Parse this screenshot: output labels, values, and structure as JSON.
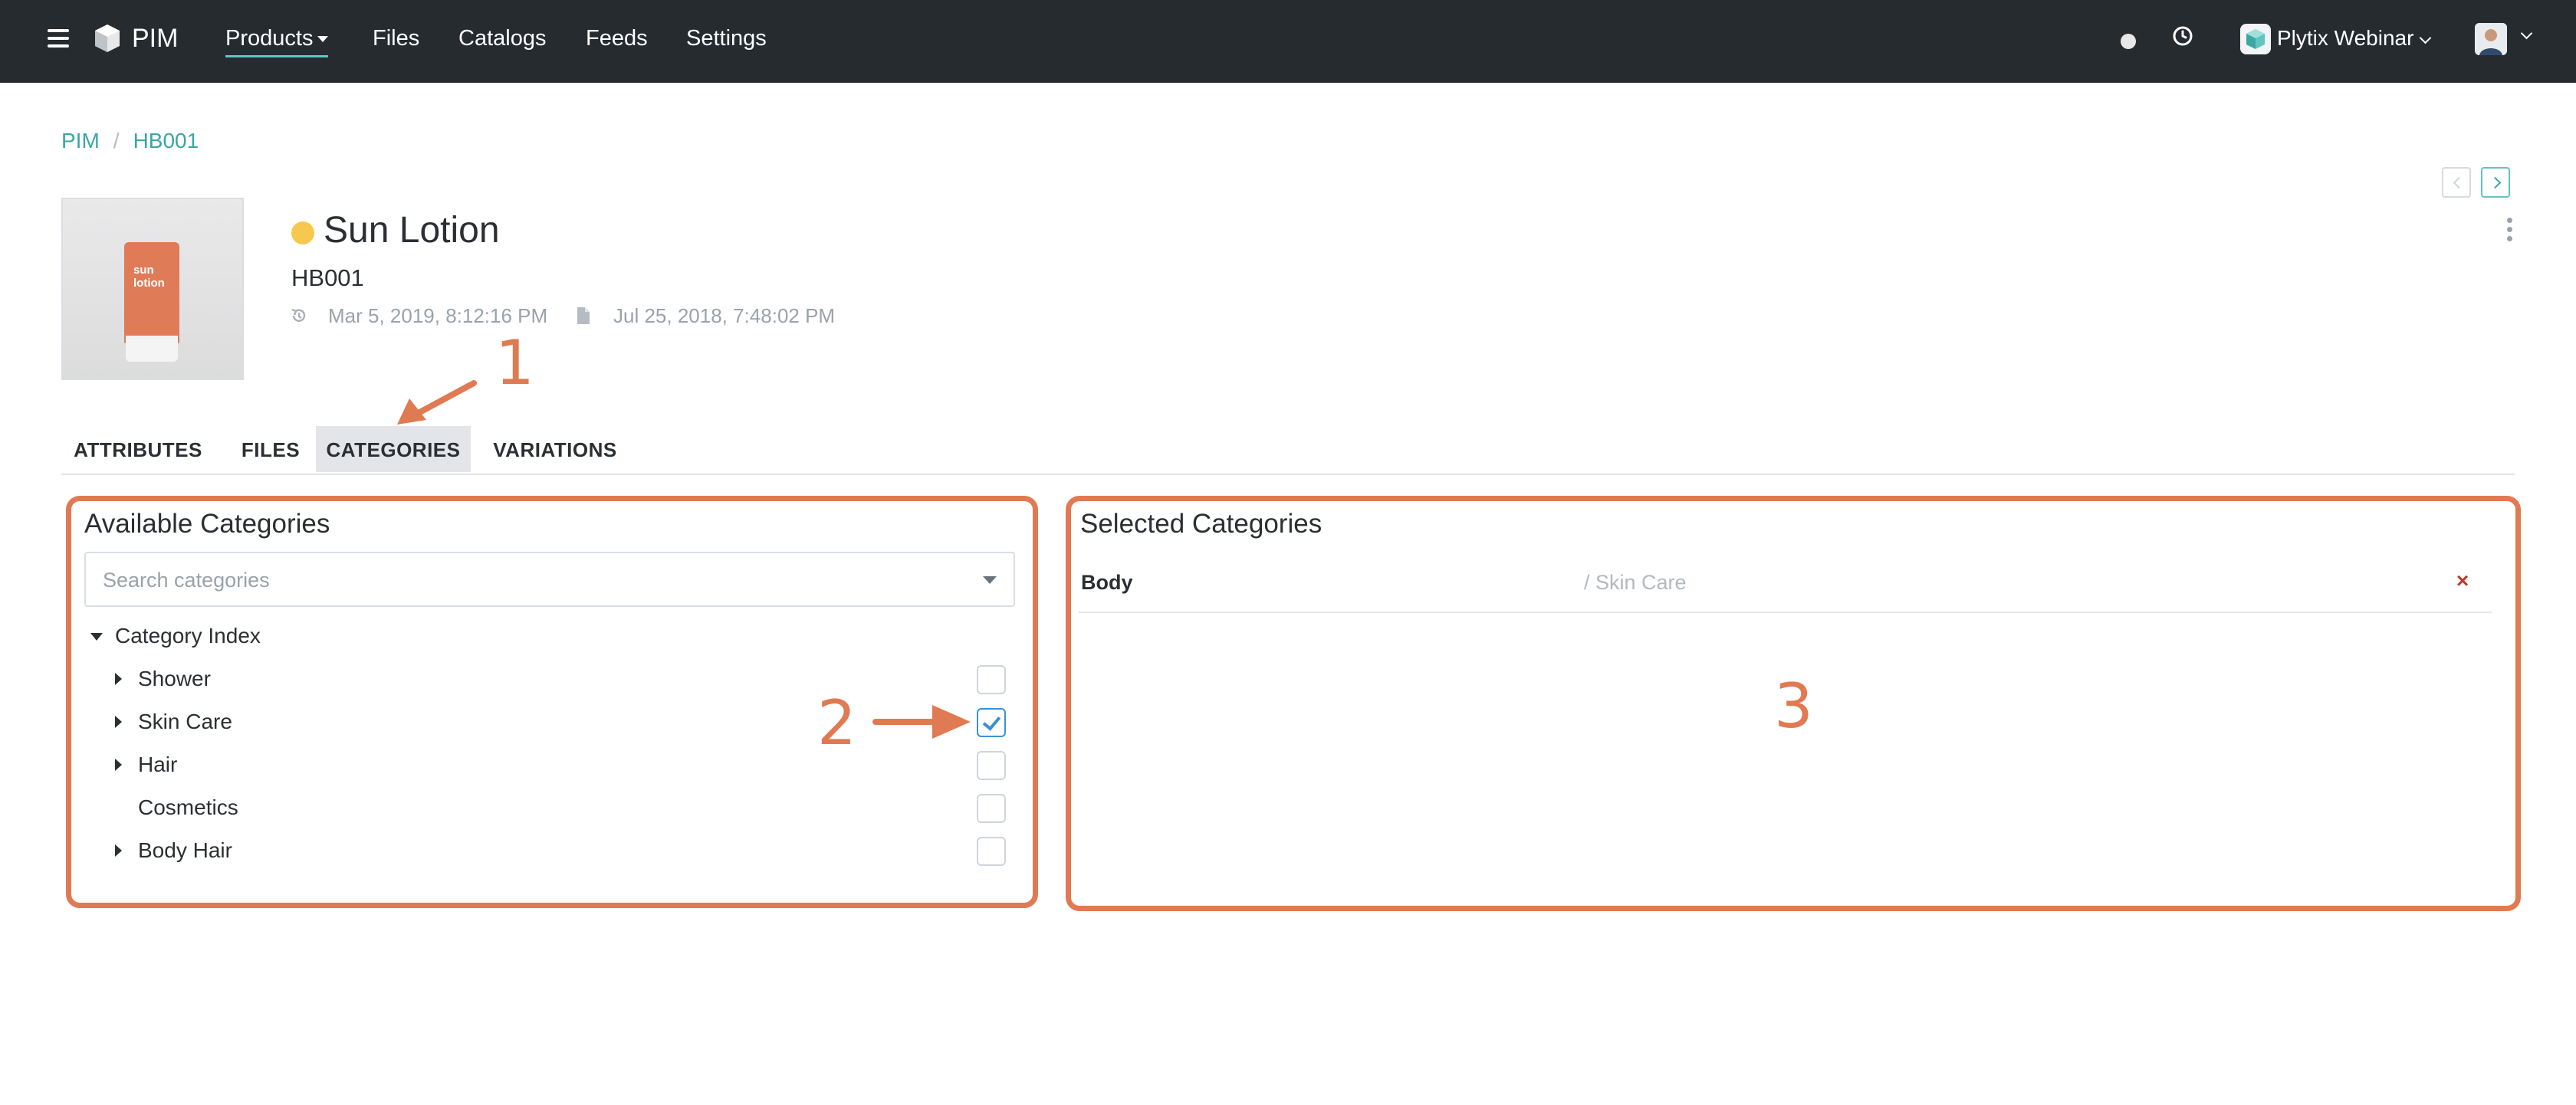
{
  "nav": {
    "brand": "PIM",
    "items": [
      {
        "label": "Products"
      },
      {
        "label": "Files"
      },
      {
        "label": "Catalogs"
      },
      {
        "label": "Feeds"
      },
      {
        "label": "Settings"
      }
    ],
    "org_name": "Plytix Webinar",
    "colors": {
      "bar": "#262b30",
      "accent": "#5fc6c0"
    }
  },
  "breadcrumb": {
    "items": [
      "PIM",
      "HB001"
    ],
    "separator": "/"
  },
  "product": {
    "title": "Sun Lotion",
    "sku": "HB001",
    "modified": "Mar 5, 2019, 8:12:16 PM",
    "created": "Jul 25, 2018, 7:48:02 PM",
    "status_color": "#f6c84e",
    "image_label": [
      "sun",
      "lotion"
    ]
  },
  "tabs": [
    {
      "label": "ATTRIBUTES",
      "active": false
    },
    {
      "label": "FILES",
      "active": false
    },
    {
      "label": "CATEGORIES",
      "active": true
    },
    {
      "label": "VARIATIONS",
      "active": false
    }
  ],
  "available": {
    "title": "Available Categories",
    "search_placeholder": "Search categories",
    "root": "Category Index",
    "items": [
      {
        "label": "Shower",
        "expandable": true,
        "checked": false
      },
      {
        "label": "Skin Care",
        "expandable": true,
        "checked": true
      },
      {
        "label": "Hair",
        "expandable": true,
        "checked": false
      },
      {
        "label": "Cosmetics",
        "expandable": false,
        "checked": false
      },
      {
        "label": "Body Hair",
        "expandable": true,
        "checked": false
      }
    ]
  },
  "selected": {
    "title": "Selected Categories",
    "rows": [
      {
        "name": "Body",
        "path": "/ Skin Care",
        "remove": "×"
      }
    ]
  },
  "annotations": {
    "one": "1",
    "two": "2",
    "three": "3",
    "color": "#e07a52"
  }
}
